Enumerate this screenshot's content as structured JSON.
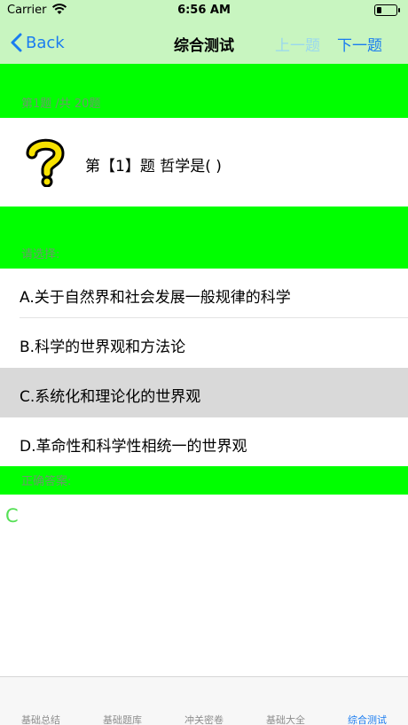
{
  "status_bar": {
    "carrier": "Carrier",
    "time": "6:56 AM",
    "battery_level": 0.25
  },
  "nav": {
    "back_label": "Back",
    "title": "综合测试",
    "prev_label": "上一题",
    "next_label": "下一题"
  },
  "progress": {
    "label": "第1题 /共 20题"
  },
  "question": {
    "icon": "question-mark-icon",
    "text": "第【1】题  哲学是( )"
  },
  "choose": {
    "label": "请选择:"
  },
  "options": [
    {
      "label": "A.关于自然界和社会发展一般规律的科学",
      "selected": false
    },
    {
      "label": "B.科学的世界观和方法论",
      "selected": false
    },
    {
      "label": "C.系统化和理论化的世界观",
      "selected": true
    },
    {
      "label": "D.革命性和科学性相统一的世界观",
      "selected": false
    }
  ],
  "answer": {
    "label": "正确答案:",
    "value": "C"
  },
  "tabs": [
    {
      "label": "基础总结",
      "active": false
    },
    {
      "label": "基础题库",
      "active": false
    },
    {
      "label": "冲关密卷",
      "active": false
    },
    {
      "label": "基础大全",
      "active": false
    },
    {
      "label": "综合测试",
      "active": true
    }
  ],
  "colors": {
    "accent": "#1a7cf0",
    "section_green": "#00ff00",
    "nav_green": "#c8f5c0",
    "answer_green": "#55e055",
    "selected_row": "#d9d9d9"
  }
}
